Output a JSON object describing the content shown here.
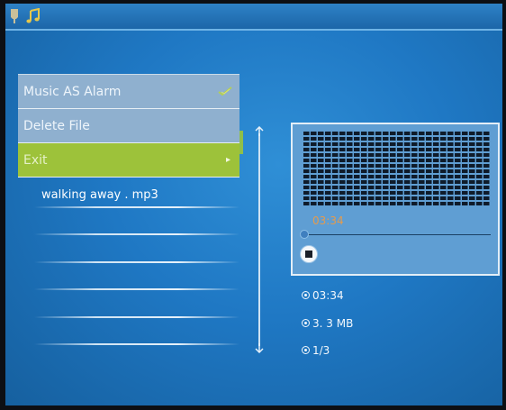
{
  "topbar": {
    "icons": [
      "pin-icon",
      "music-note-icon"
    ]
  },
  "menu": {
    "items": [
      {
        "label": "Music AS Alarm",
        "checked": true
      },
      {
        "label": "Delete File"
      },
      {
        "label": "Exit",
        "selected": true
      }
    ]
  },
  "file_list": {
    "items": [
      "walking away . mp3",
      "",
      "",
      "",
      "",
      ""
    ]
  },
  "player": {
    "elapsed": "03:34",
    "progress": 0.0,
    "stop_icon": "stop-icon"
  },
  "info": {
    "duration": "03:34",
    "size": "3. 3 MB",
    "track": "1/3"
  },
  "colors": {
    "background": "#1f78c4",
    "menu_item": "#8fb0cf",
    "menu_selected": "#9dc23a",
    "elapsed_text": "#e59b4d"
  }
}
